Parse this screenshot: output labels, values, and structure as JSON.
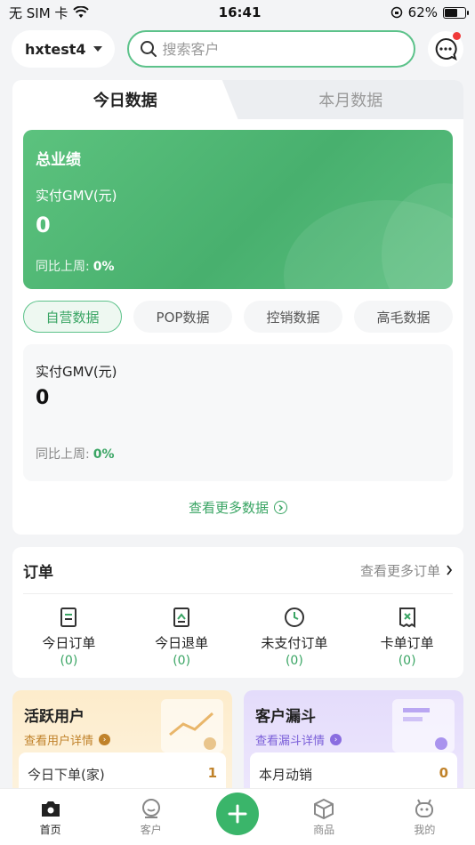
{
  "status": {
    "carrier": "无 SIM 卡",
    "time": "16:41",
    "battery": "62%"
  },
  "header": {
    "store_name": "hxtest4",
    "search_placeholder": "搜索客户"
  },
  "data_tabs": [
    "今日数据",
    "本月数据"
  ],
  "total": {
    "title": "总业绩",
    "label": "实付GMV(元)",
    "value": "0",
    "compare_label": "同比上周:",
    "compare_value": "0%"
  },
  "segments": [
    "自营数据",
    "POP数据",
    "控销数据",
    "高毛数据"
  ],
  "segment_detail": {
    "label": "实付GMV(元)",
    "value": "0",
    "compare_label": "同比上周:",
    "compare_value": "0%"
  },
  "more_data": "查看更多数据",
  "orders": {
    "title": "订单",
    "more": "查看更多订单",
    "items": [
      {
        "label": "今日订单",
        "count": "(0)",
        "icon": "order-doc-icon"
      },
      {
        "label": "今日退单",
        "count": "(0)",
        "icon": "return-doc-icon"
      },
      {
        "label": "未支付订单",
        "count": "(0)",
        "icon": "clock-icon"
      },
      {
        "label": "卡单订单",
        "count": "(0)",
        "icon": "stuck-doc-icon"
      }
    ]
  },
  "active_users": {
    "title": "活跃用户",
    "link": "查看用户详情",
    "row_label": "今日下单(家)",
    "row_value": "1"
  },
  "funnel": {
    "title": "客户漏斗",
    "link": "查看漏斗详情",
    "row_label": "本月动销",
    "row_value": "0"
  },
  "tabbar": [
    "首页",
    "客户",
    "商品",
    "我的"
  ],
  "colors": {
    "accent": "#3aa564",
    "green_panel": "#4fb574",
    "orange_card": "#fdeccb",
    "purple_card": "#e4dcfb"
  }
}
